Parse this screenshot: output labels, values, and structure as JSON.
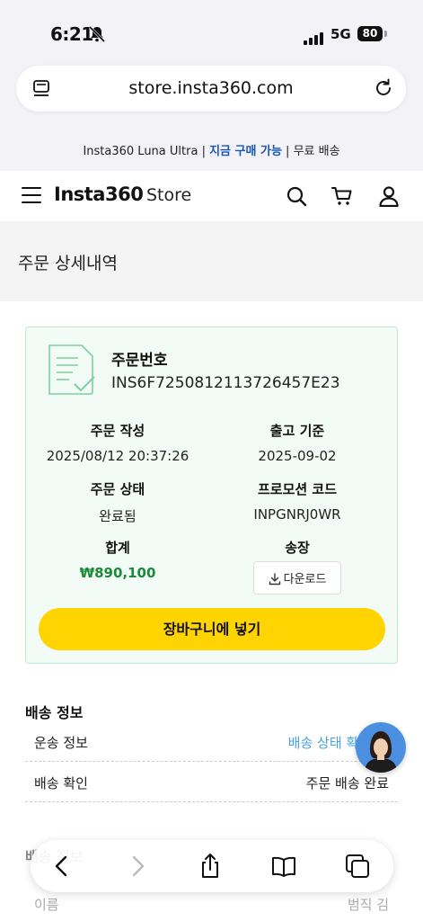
{
  "status_bar": {
    "time": "6:21",
    "network": "5G",
    "battery": "80"
  },
  "browser": {
    "url": "store.insta360.com"
  },
  "promo": {
    "product": "Insta360 Luna Ultra",
    "sep1": " | ",
    "highlight": "지금 구매 가능",
    "sep2": " | ",
    "shipping": "무료 배송"
  },
  "header": {
    "logo": "Insta360",
    "store": "Store"
  },
  "page_title": "주문 상세내역",
  "order": {
    "number_label": "주문번호",
    "number": "INS6F7250812113726457E23",
    "created_label": "주문 작성",
    "created": "2025/08/12 20:37:26",
    "ship_label": "출고 기준",
    "ship": "2025-09-02",
    "status_label": "주문 상태",
    "status": "완료됨",
    "promo_label": "프로모션 코드",
    "promo_code": "INPGNRJ0WR",
    "total_label": "합계",
    "total": "₩890,100",
    "invoice_label": "송장",
    "download_label": "다운로드",
    "cart_button": "장바구니에 넣기"
  },
  "shipping": {
    "title": "배송 정보",
    "rows": [
      {
        "label": "운송 정보",
        "value": "배송 상태 확인"
      },
      {
        "label": "배송 확인",
        "value": "주문 배송 완료"
      }
    ]
  },
  "faded": {
    "section": "배송 정보",
    "name_label": "이름",
    "name_value": "범직 김"
  },
  "colors": {
    "accent_yellow": "#ffd400",
    "total_green": "#1b8a3a",
    "link_blue": "#4aa3e0",
    "card_border": "#bfe8d3"
  },
  "icons": [
    "bell-slash-icon",
    "tabs-icon",
    "reload-icon",
    "menu-icon",
    "search-icon",
    "cart-icon",
    "user-icon",
    "document-check-icon",
    "download-icon",
    "back-icon",
    "forward-icon",
    "share-icon",
    "bookmarks-icon",
    "tabs-overview-icon"
  ]
}
